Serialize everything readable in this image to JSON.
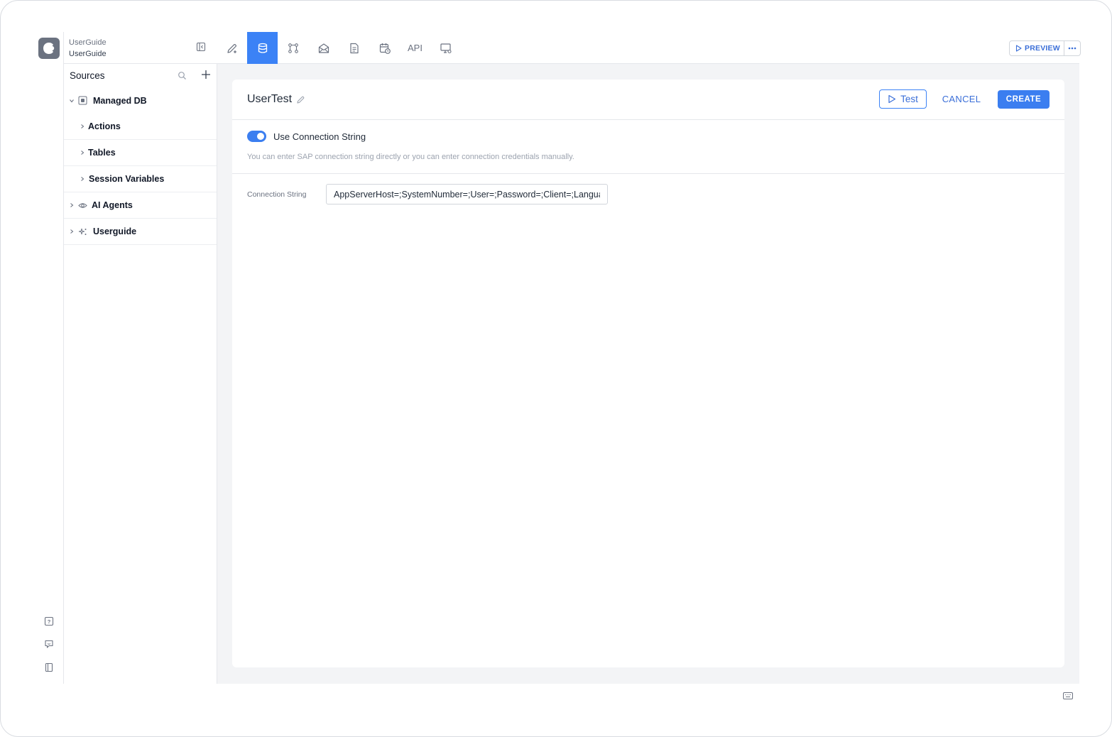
{
  "app": {
    "workspace": "UserGuide",
    "name": "UserGuide"
  },
  "nav_tabs": [
    {
      "id": "editor",
      "icon": "edit-pen-icon"
    },
    {
      "id": "data",
      "icon": "database-icon",
      "active": true
    },
    {
      "id": "workflow",
      "icon": "workflow-nodes-icon"
    },
    {
      "id": "email",
      "icon": "envelope-icon"
    },
    {
      "id": "documents",
      "icon": "document-icon"
    },
    {
      "id": "schedule",
      "icon": "calendar-clock-icon"
    },
    {
      "id": "api",
      "label": "API"
    },
    {
      "id": "devices",
      "icon": "monitor-settings-icon"
    }
  ],
  "header": {
    "preview_label": "PREVIEW",
    "more_label": "..."
  },
  "sidebar": {
    "title": "Sources",
    "tree": [
      {
        "label": "Managed DB",
        "level": 0,
        "expanded": true,
        "icon": "database-box-icon"
      },
      {
        "label": "Actions",
        "level": 1,
        "expanded": false
      },
      {
        "label": "Tables",
        "level": 1,
        "expanded": false
      },
      {
        "label": "Session Variables",
        "level": 1,
        "expanded": false
      },
      {
        "label": "AI Agents",
        "level": 0,
        "expanded": false,
        "icon": "eye-icon"
      },
      {
        "label": "Userguide",
        "level": 0,
        "expanded": false,
        "icon": "sparkle-icon"
      }
    ]
  },
  "datasource": {
    "name": "UserTest",
    "test_label": "Test",
    "cancel_label": "CANCEL",
    "create_label": "CREATE",
    "toggle_label": "Use Connection String",
    "toggle_on": true,
    "hint": "You can enter SAP connection string directly or you can enter connection credentials manually.",
    "field_label": "Connection String",
    "field_value": "AppServerHost=;SystemNumber=;User=;Password=;Client=;Language=;"
  },
  "colors": {
    "accent": "#3b7ef0",
    "accent_text": "#3b6fd8",
    "content_bg": "#f3f4f6"
  }
}
